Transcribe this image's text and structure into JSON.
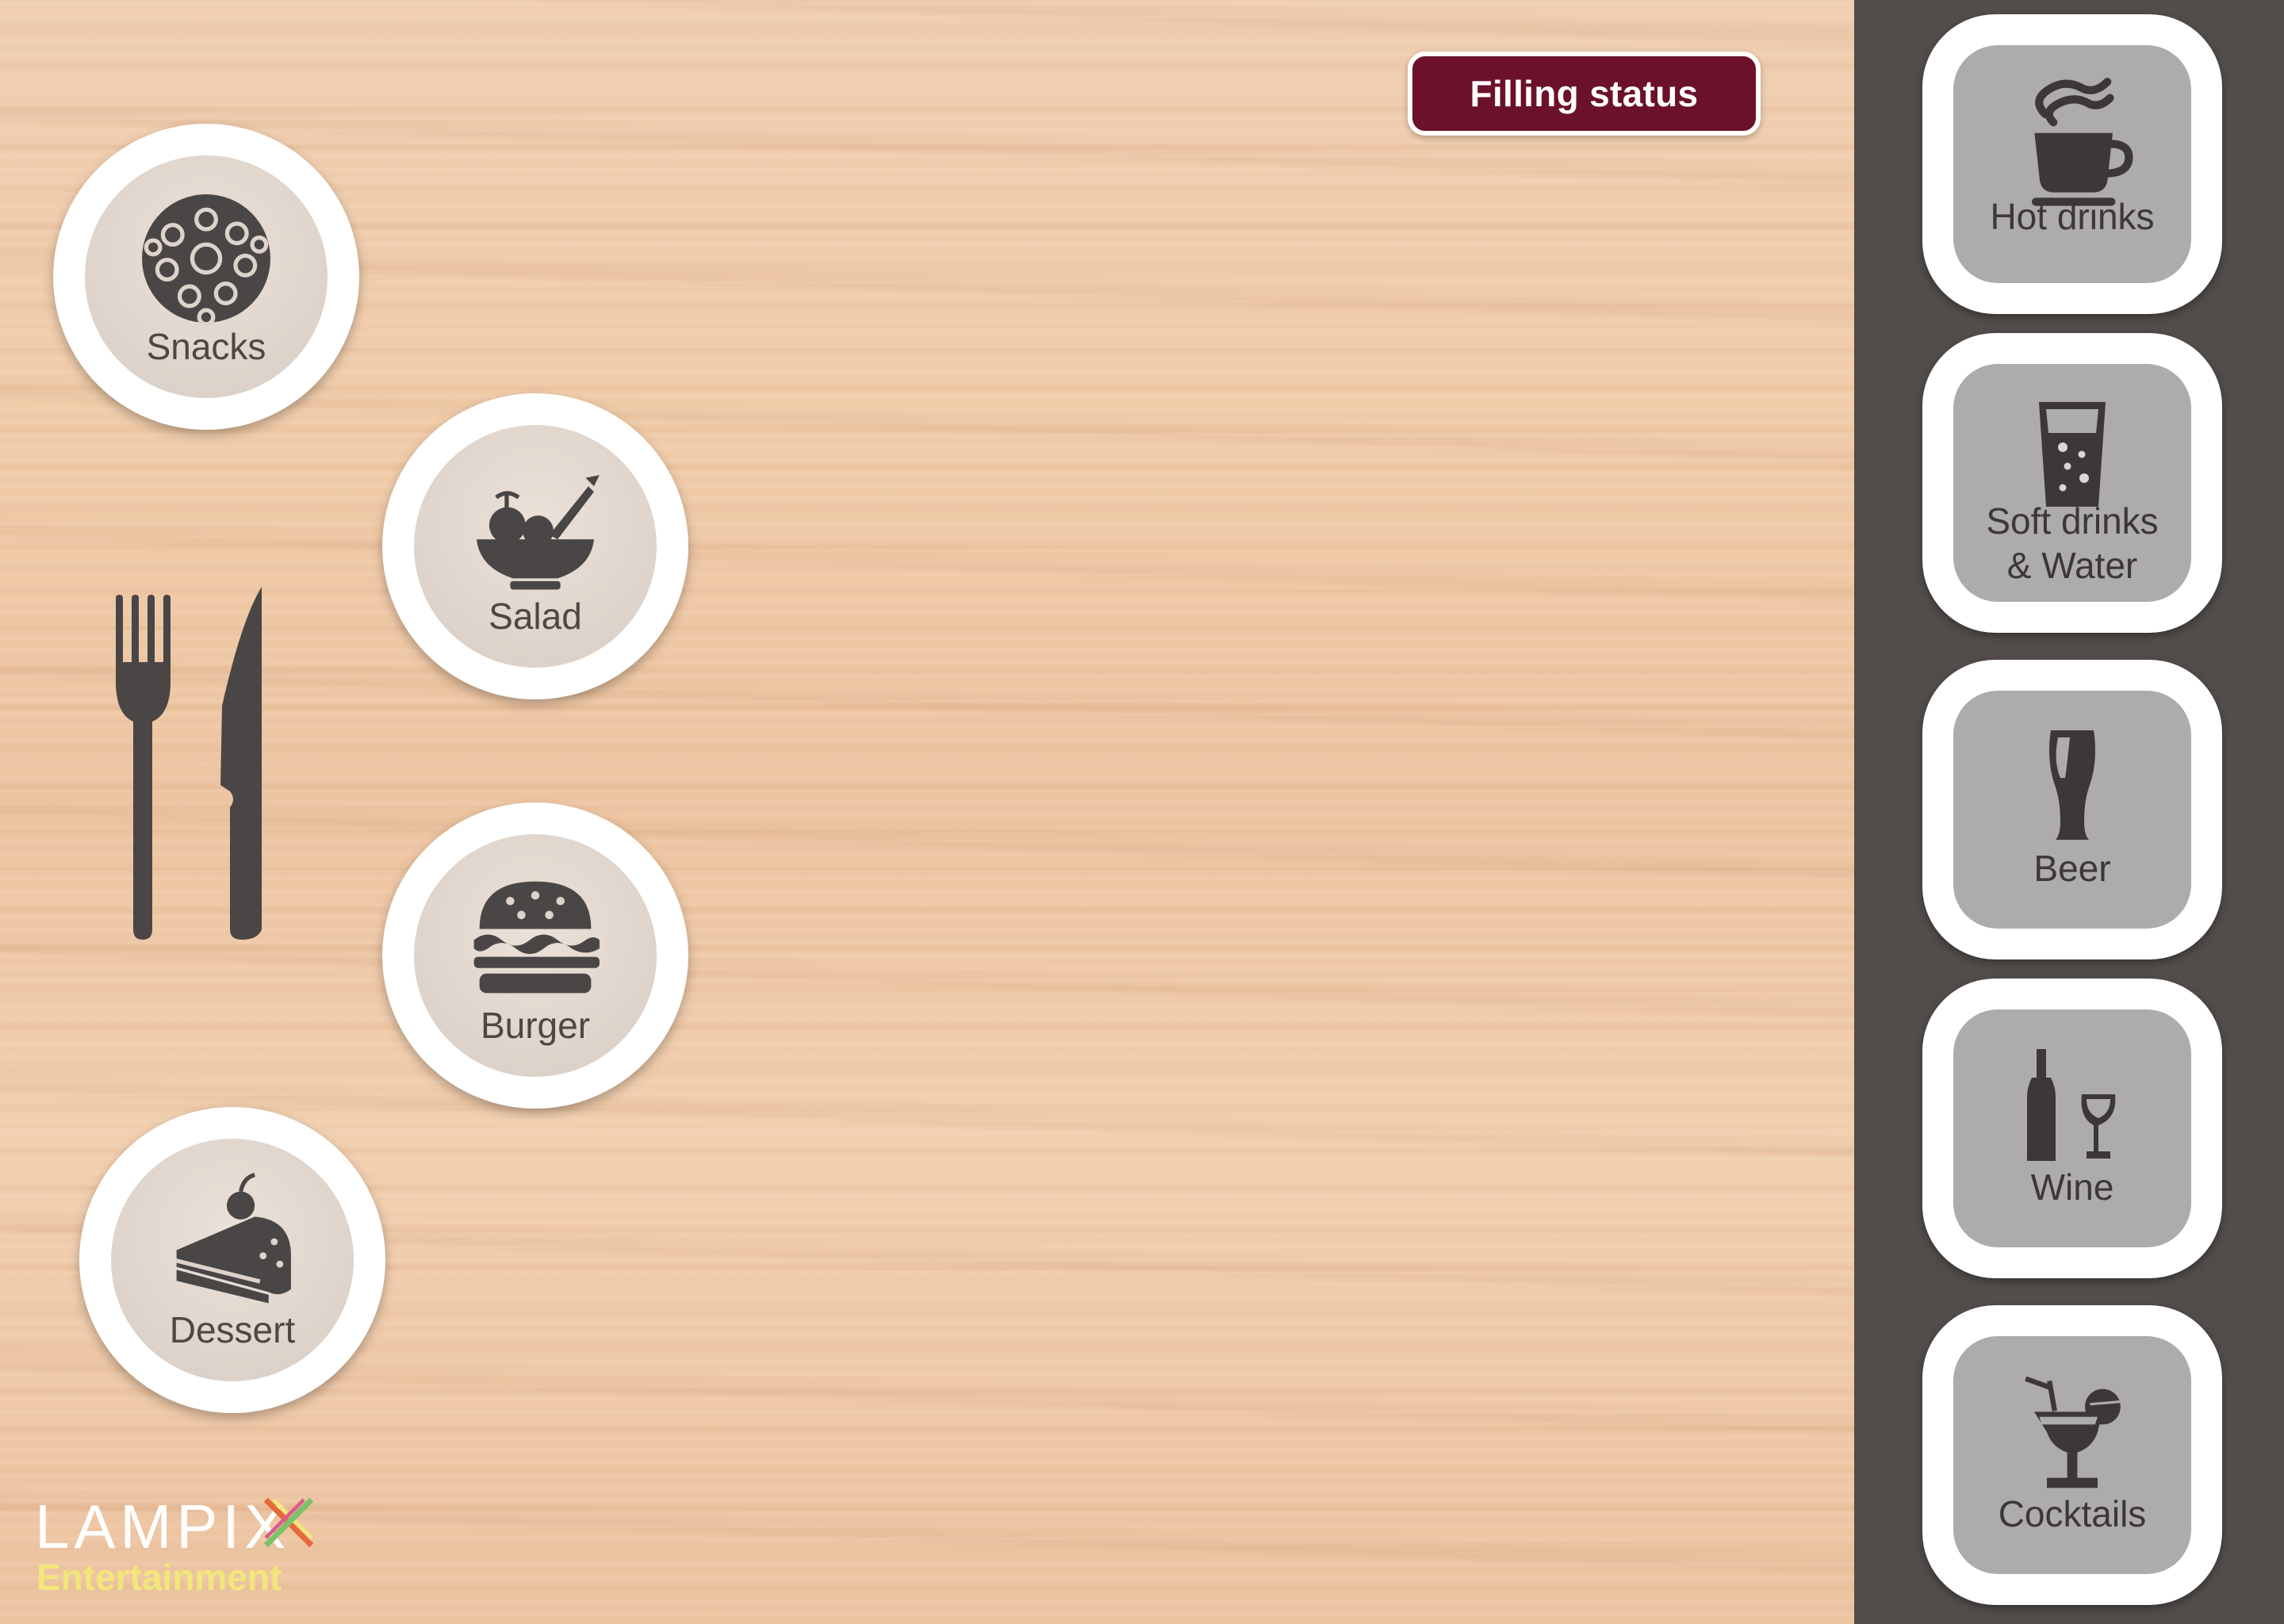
{
  "header": {
    "filling_status_label": "Filling status"
  },
  "food_items": [
    {
      "label": "Snacks",
      "icon": "donut-icon"
    },
    {
      "label": "Salad",
      "icon": "salad-bowl-icon"
    },
    {
      "label": "Burger",
      "icon": "burger-icon"
    },
    {
      "label": "Dessert",
      "icon": "cake-slice-icon"
    }
  ],
  "drinks": [
    {
      "label_line1": "Hot drinks",
      "label_line2": "",
      "icon": "coffee-cup-icon"
    },
    {
      "label_line1": "Soft drinks",
      "label_line2": "& Water",
      "icon": "soda-glass-icon"
    },
    {
      "label_line1": "Beer",
      "label_line2": "",
      "icon": "beer-glass-icon"
    },
    {
      "label_line1": "Wine",
      "label_line2": "",
      "icon": "wine-bottle-glass-icon"
    },
    {
      "label_line1": "Cocktails",
      "label_line2": "",
      "icon": "cocktail-icon"
    }
  ],
  "logo": {
    "brand": "LAMPIX",
    "sub": "Entertainment"
  },
  "colors": {
    "accent": "#6b1129",
    "sidebar": "#524d4b",
    "icon_dark": "#4a4646",
    "tile_gray": "#aeacab",
    "logo_sub": "#f3e67a"
  }
}
